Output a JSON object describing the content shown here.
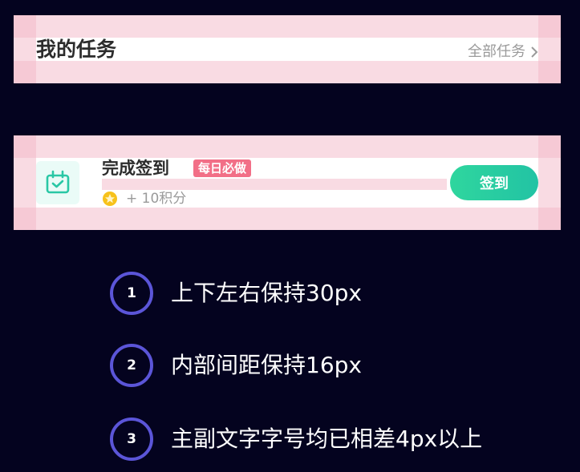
{
  "header_card": {
    "title": "我的任务",
    "more_label": "全部任务",
    "more_icon": "chevron-right-icon"
  },
  "task_card": {
    "icon": "calendar-check-icon",
    "title": "完成签到",
    "badge": "每日必做",
    "reward_icon": "coin-star-icon",
    "reward": "+ 10积分",
    "button_label": "签到"
  },
  "notes": [
    {
      "number": "1",
      "text": "上下左右保持30px"
    },
    {
      "number": "2",
      "text": "内部间距保持16px"
    },
    {
      "number": "3",
      "text": "主副文字字号均已相差4px以上"
    }
  ],
  "colors": {
    "background": "#04031f",
    "card": "#ffffff",
    "guide_overlay": "#f4b8c8",
    "accent_green": "#2fd69e",
    "badge_red": "#f26f87",
    "note_ring": "#5b55d8",
    "coin_yellow": "#f7c21b"
  }
}
